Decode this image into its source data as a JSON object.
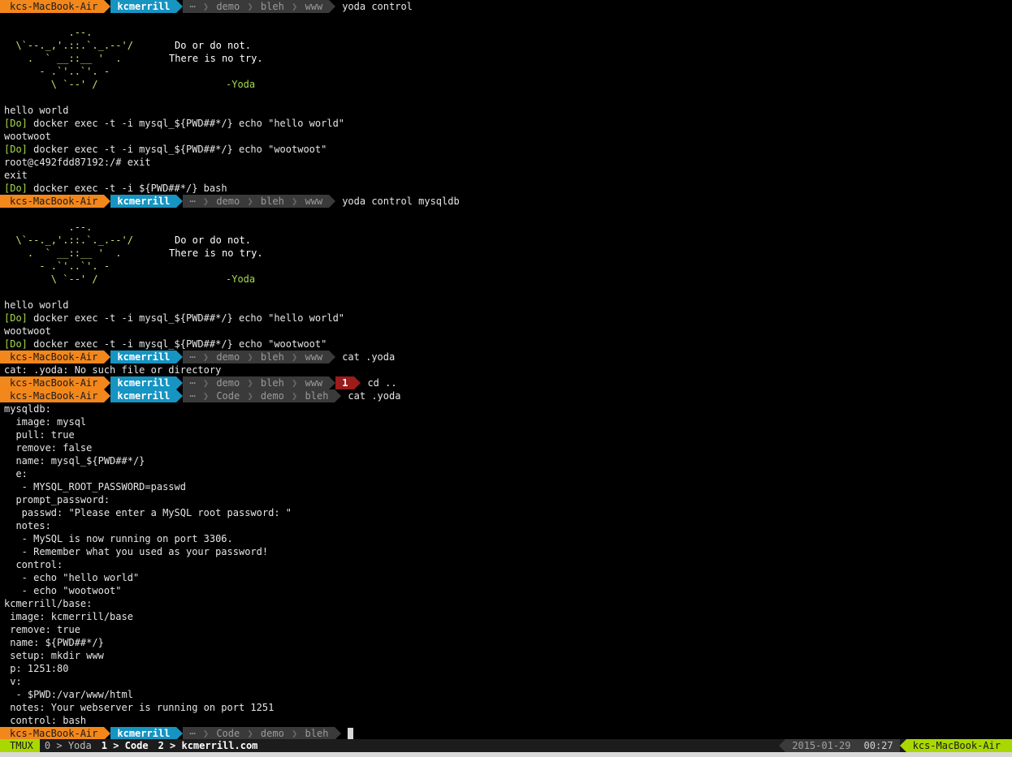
{
  "prompt": {
    "host": "kcs-MacBook-Air",
    "user": "kcmerrill",
    "ellipsis": "⋯"
  },
  "yoda_art": [
    "           .--.",
    "  \\`--._,'.::.`._.--'/",
    "    .  ` __::__ '  .",
    "      - .`'..`'. -",
    "        \\ `--' /"
  ],
  "yoda_quote": [
    "Do or do not.",
    "There is no try.",
    "-Yoda"
  ],
  "terminal": {
    "block1": {
      "path": [
        "demo",
        "bleh",
        "www"
      ],
      "command": "yoda control",
      "out": [
        "hello world",
        "[Do]|docker exec -t -i mysql_${PWD##*/} echo \"hello world\"",
        "wootwoot",
        "[Do]|docker exec -t -i mysql_${PWD##*/} echo \"wootwoot\"",
        "root@c492fdd87192:/# exit",
        "exit",
        "[Do]|docker exec -t -i ${PWD##*/} bash"
      ]
    },
    "block2": {
      "path": [
        "demo",
        "bleh",
        "www"
      ],
      "command": "yoda control mysqldb",
      "out": [
        "hello world",
        "[Do]|docker exec -t -i mysql_${PWD##*/} echo \"hello world\"",
        "wootwoot",
        "[Do]|docker exec -t -i mysql_${PWD##*/} echo \"wootwoot\""
      ]
    },
    "block3": {
      "path": [
        "demo",
        "bleh",
        "www"
      ],
      "command": "cat .yoda",
      "out": "cat: .yoda: No such file or directory"
    },
    "block4": {
      "path": [
        "demo",
        "bleh",
        "www"
      ],
      "exit_code": "1",
      "command": "cd .."
    },
    "block5": {
      "path": [
        "Code",
        "demo",
        "bleh"
      ],
      "command": "cat .yoda",
      "yaml": [
        "mysqldb:",
        "  image: mysql",
        "  pull: true",
        "  remove: false",
        "  name: mysql_${PWD##*/}",
        "  e:",
        "   - MYSQL_ROOT_PASSWORD=passwd",
        "  prompt_password:",
        "   passwd: \"Please enter a MySQL root password: \"",
        "  notes:",
        "   - MySQL is now running on port 3306.",
        "   - Remember what you used as your password!",
        "  control:",
        "   - echo \"hello world\"",
        "   - echo \"wootwoot\"",
        "kcmerrill/base:",
        " image: kcmerrill/base",
        " remove: true",
        " name: ${PWD##*/}",
        " setup: mkdir www",
        " p: 1251:80",
        " v:",
        "  - $PWD:/var/www/html",
        " notes: Your webserver is running on port 1251",
        " control: bash"
      ]
    },
    "block6": {
      "path": [
        "Code",
        "demo",
        "bleh"
      ]
    }
  },
  "tmux": {
    "label": "TMUX",
    "windows": [
      {
        "index": "0",
        "name": "Yoda"
      },
      {
        "index": "1",
        "name": "Code"
      },
      {
        "index": "2",
        "name": "kcmerrill.com"
      }
    ],
    "date": "2015-01-29",
    "time": "00:27",
    "host": "kcs-MacBook-Air"
  },
  "colors": {
    "host_bg": "#f2871c",
    "user_bg": "#1694c2",
    "path_bg": "#3a3a3a",
    "error_bg": "#9c1b1b",
    "tmux_green": "#a8d800",
    "ascii_green": "#cde56b"
  }
}
